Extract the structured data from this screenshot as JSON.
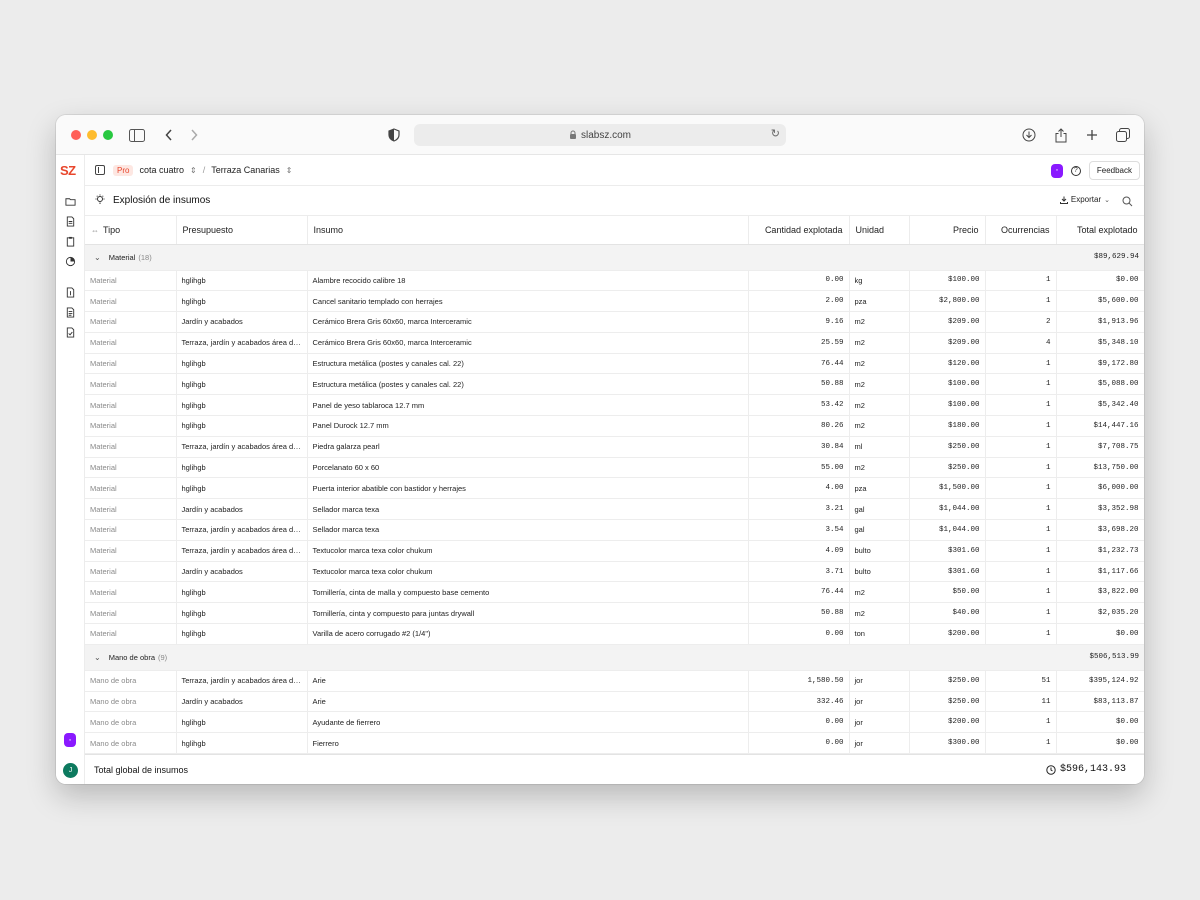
{
  "browser": {
    "url": "slabsz.com"
  },
  "app": {
    "logo": "SZ",
    "pro_badge": "Pro",
    "project": "cota cuatro",
    "subproject": "Terraza Canarias",
    "feedback_label": "Feedback",
    "page_title": "Explosión de insumos",
    "export_label": "Exportar",
    "user_initial": "J",
    "brand_color": "#e8462c",
    "accent_color": "#8a19ff"
  },
  "table": {
    "headers": {
      "tipo": "Tipo",
      "presupuesto": "Presupuesto",
      "insumo": "Insumo",
      "cantidad": "Cantidad explotada",
      "unidad": "Unidad",
      "precio": "Precio",
      "ocurrencias": "Ocurrencias",
      "total": "Total explotado"
    },
    "groups": [
      {
        "name": "Material",
        "count": "(18)",
        "total": "$89,629.94",
        "rows": [
          [
            "Material",
            "hglihgb",
            "Alambre recocido calibre 18",
            "0.00",
            "kg",
            "$100.00",
            "1",
            "$0.00"
          ],
          [
            "Material",
            "hglihgb",
            "Cancel sanitario templado con herrajes",
            "2.00",
            "pza",
            "$2,800.00",
            "1",
            "$5,600.00"
          ],
          [
            "Material",
            "Jardín y acabados",
            "Cerámico Brera Gris 60x60, marca Interceramic",
            "9.16",
            "m2",
            "$209.00",
            "2",
            "$1,913.96"
          ],
          [
            "Material",
            "Terraza, jardín y acabados área de se...",
            "Cerámico Brera Gris 60x60, marca Interceramic",
            "25.59",
            "m2",
            "$209.00",
            "4",
            "$5,348.10"
          ],
          [
            "Material",
            "hglihgb",
            "Estructura metálica (postes y canales cal. 22)",
            "76.44",
            "m2",
            "$120.00",
            "1",
            "$9,172.80"
          ],
          [
            "Material",
            "hglihgb",
            "Estructura metálica (postes y canales cal. 22)",
            "50.88",
            "m2",
            "$100.00",
            "1",
            "$5,088.00"
          ],
          [
            "Material",
            "hglihgb",
            "Panel de yeso tablaroca 12.7 mm",
            "53.42",
            "m2",
            "$100.00",
            "1",
            "$5,342.40"
          ],
          [
            "Material",
            "hglihgb",
            "Panel Durock 12.7 mm",
            "80.26",
            "m2",
            "$180.00",
            "1",
            "$14,447.16"
          ],
          [
            "Material",
            "Terraza, jardín y acabados área de se...",
            "Piedra galarza pearl",
            "30.84",
            "ml",
            "$250.00",
            "1",
            "$7,708.75"
          ],
          [
            "Material",
            "hglihgb",
            "Porcelanato 60 x 60",
            "55.00",
            "m2",
            "$250.00",
            "1",
            "$13,750.00"
          ],
          [
            "Material",
            "hglihgb",
            "Puerta interior abatible con bastidor y herrajes",
            "4.00",
            "pza",
            "$1,500.00",
            "1",
            "$6,000.00"
          ],
          [
            "Material",
            "Jardín y acabados",
            "Sellador marca texa",
            "3.21",
            "gal",
            "$1,044.00",
            "1",
            "$3,352.98"
          ],
          [
            "Material",
            "Terraza, jardín y acabados área de se...",
            "Sellador marca texa",
            "3.54",
            "gal",
            "$1,044.00",
            "1",
            "$3,698.20"
          ],
          [
            "Material",
            "Terraza, jardín y acabados área de se...",
            "Textucolor marca texa color chukum",
            "4.09",
            "bulto",
            "$301.60",
            "1",
            "$1,232.73"
          ],
          [
            "Material",
            "Jardín y acabados",
            "Textucolor marca texa color chukum",
            "3.71",
            "bulto",
            "$301.60",
            "1",
            "$1,117.66"
          ],
          [
            "Material",
            "hglihgb",
            "Tornillería, cinta de malla y compuesto base cemento",
            "76.44",
            "m2",
            "$50.00",
            "1",
            "$3,822.00"
          ],
          [
            "Material",
            "hglihgb",
            "Tornillería, cinta y compuesto para juntas drywall",
            "50.88",
            "m2",
            "$40.00",
            "1",
            "$2,035.20"
          ],
          [
            "Material",
            "hglihgb",
            "Varilla de acero corrugado #2 (1/4\")",
            "0.00",
            "ton",
            "$200.00",
            "1",
            "$0.00"
          ]
        ]
      },
      {
        "name": "Mano de obra",
        "count": "(9)",
        "total": "$506,513.99",
        "rows": [
          [
            "Mano de obra",
            "Terraza, jardín y acabados área de se...",
            "Arie",
            "1,580.50",
            "jor",
            "$250.00",
            "51",
            "$395,124.92"
          ],
          [
            "Mano de obra",
            "Jardín y acabados",
            "Arie",
            "332.46",
            "jor",
            "$250.00",
            "11",
            "$83,113.87"
          ],
          [
            "Mano de obra",
            "hglihgb",
            "Ayudante de fierrero",
            "0.00",
            "jor",
            "$200.00",
            "1",
            "$0.00"
          ],
          [
            "Mano de obra",
            "hglihgb",
            "Fierrero",
            "0.00",
            "jor",
            "$300.00",
            "1",
            "$0.00"
          ]
        ]
      }
    ]
  },
  "footer": {
    "label": "Total global de insumos",
    "total": "$596,143.93"
  }
}
